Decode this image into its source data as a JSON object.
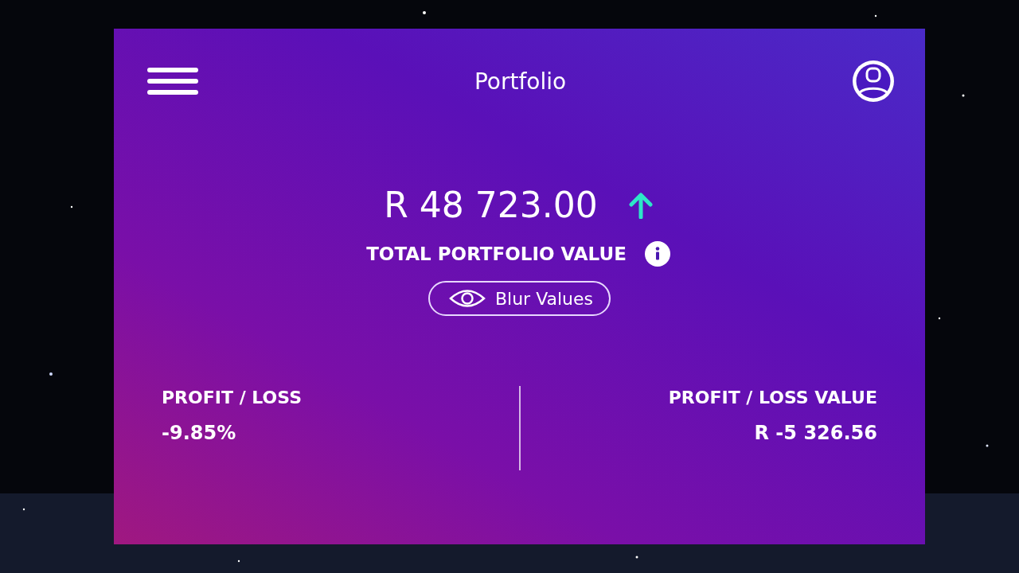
{
  "header": {
    "title": "Portfolio"
  },
  "total": {
    "amount": "R 48 723.00",
    "rising": true,
    "label": "TOTAL PORTFOLIO VALUE"
  },
  "blur_button": {
    "label": "Blur Values"
  },
  "stats": [
    {
      "label": "PROFIT / LOSS",
      "value": "-9.85%"
    },
    {
      "label": "PROFIT / LOSS VALUE",
      "value": "R -5 326.56"
    }
  ]
}
